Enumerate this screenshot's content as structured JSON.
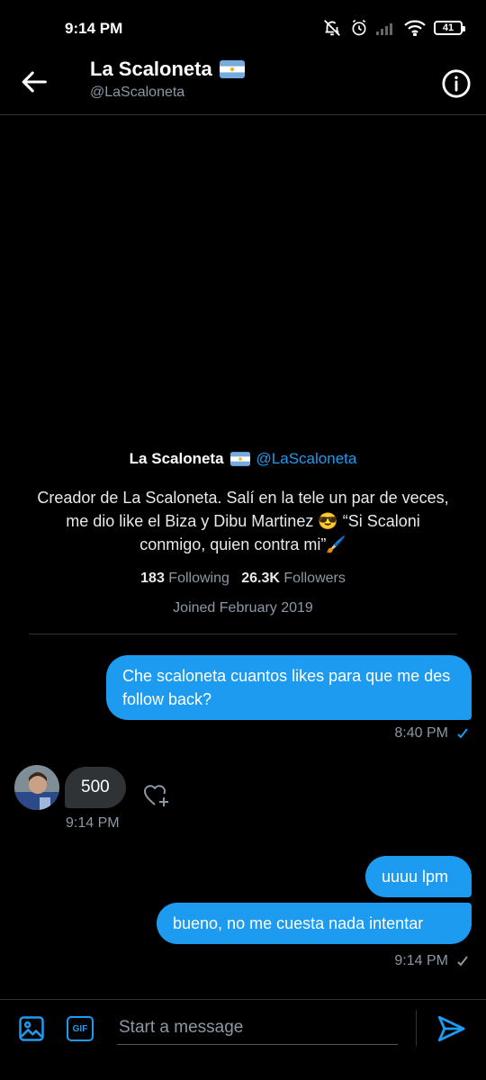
{
  "status": {
    "time": "9:14 PM",
    "battery": "41"
  },
  "header": {
    "name": "La Scaloneta",
    "handle": "@LaScaloneta"
  },
  "profile": {
    "name": "La Scaloneta",
    "handle": "@LaScaloneta",
    "bio": "Creador de La Scaloneta. Salí en la tele un par de veces, me dio like el Biza y Dibu Martinez 😎 “Si Scaloni conmigo, quien contra mi”🖌️",
    "following_count": "183",
    "following_label": "Following",
    "followers_count": "26.3K",
    "followers_label": "Followers",
    "joined": "Joined February 2019"
  },
  "messages": [
    {
      "text": "Che scaloneta cuantos likes para que me des follow back?",
      "time": "8:40 PM"
    },
    {
      "text": "500",
      "time": "9:14 PM"
    },
    {
      "text": "uuuu lpm"
    },
    {
      "text": "bueno, no me cuesta nada intentar",
      "time": "9:14 PM"
    }
  ],
  "compose": {
    "placeholder": "Start a message",
    "gif_label": "GIF"
  },
  "colors": {
    "accent": "#1d9bf0",
    "incoming_bubble": "#2f3336",
    "muted": "#8b98a5"
  },
  "icons": [
    "back-arrow-icon",
    "info-icon",
    "image-icon",
    "gif-icon",
    "send-icon",
    "heart-plus-icon",
    "check-icon",
    "argentina-flag-icon"
  ]
}
